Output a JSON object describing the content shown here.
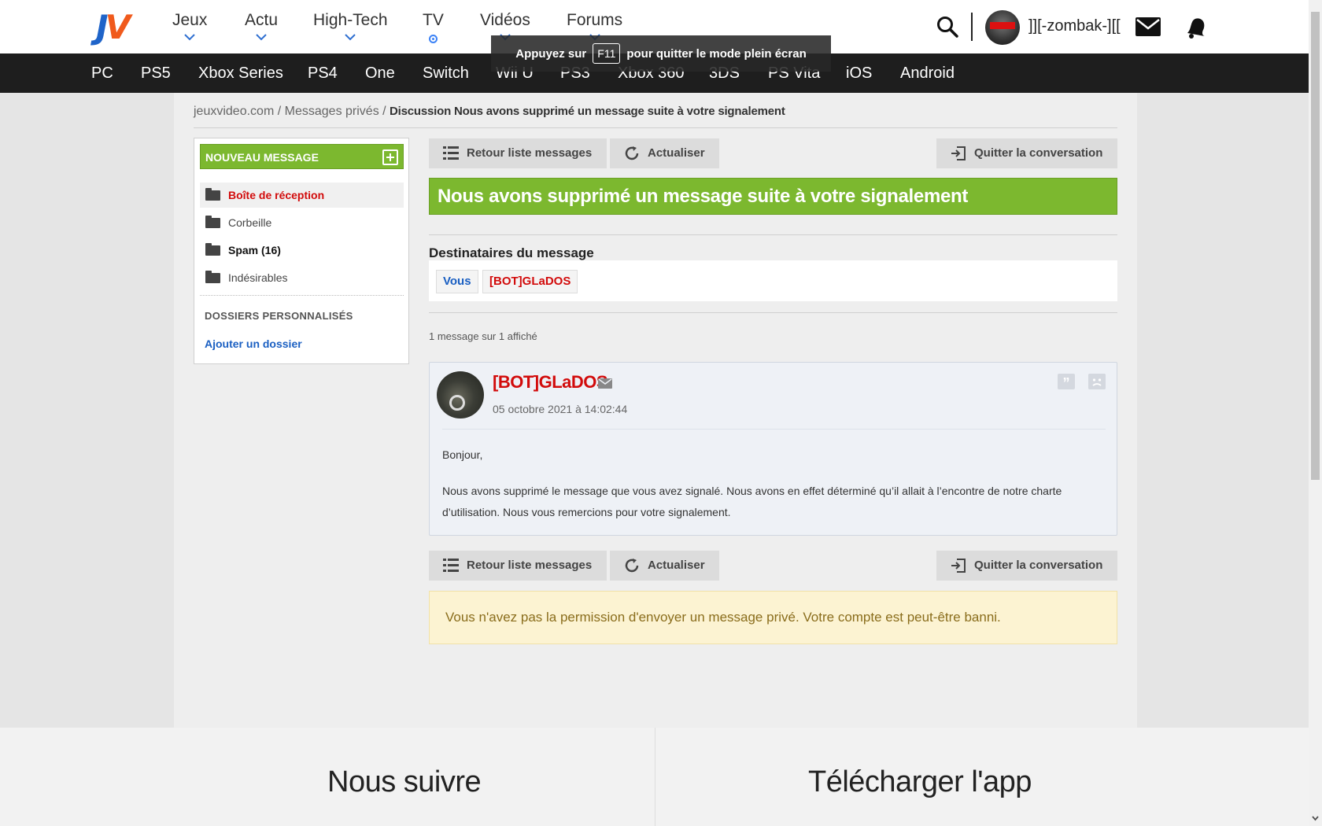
{
  "header": {
    "logo": {
      "j": "J",
      "v": "V"
    },
    "nav": [
      {
        "label": "Jeux",
        "marker": "chevron"
      },
      {
        "label": "Actu",
        "marker": "chevron"
      },
      {
        "label": "High-Tech",
        "marker": "chevron"
      },
      {
        "label": "TV",
        "marker": "live-dot"
      },
      {
        "label": "Vidéos",
        "marker": "chevron"
      },
      {
        "label": "Forums",
        "marker": "chevron"
      }
    ],
    "username": "]][-zombak-][[",
    "icons": [
      "search-icon",
      "mail-icon",
      "bell-icon"
    ]
  },
  "fullscreen_notice": {
    "before": "Appuyez sur",
    "key": "F11",
    "after": "pour quitter le mode plein écran"
  },
  "platforms": [
    "PC",
    "PS5",
    "Xbox Series",
    "PS4",
    "One",
    "Switch",
    "Wii U",
    "PS3",
    "Xbox 360",
    "3DS",
    "PS Vita",
    "iOS",
    "Android"
  ],
  "breadcrumb": {
    "home": "jeuxvideo.com",
    "sep": "/",
    "section": "Messages privés",
    "current": "Discussion Nous avons supprimé un message suite à votre signalement"
  },
  "sidebar": {
    "new_message": "NOUVEAU MESSAGE",
    "folders": [
      {
        "label": "Boîte de réception",
        "state": "active"
      },
      {
        "label": "Corbeille",
        "state": "normal"
      },
      {
        "label": "Spam (16)",
        "state": "bold"
      },
      {
        "label": "Indésirables",
        "state": "normal"
      }
    ],
    "custom_title": "DOSSIERS PERSONNALISÉS",
    "add_folder": "Ajouter un dossier"
  },
  "toolbar": {
    "back": "Retour liste messages",
    "refresh": "Actualiser",
    "leave": "Quitter la conversation"
  },
  "conversation": {
    "title": "Nous avons supprimé un message suite à votre signalement",
    "recipients_title": "Destinataires du message",
    "recipients": [
      {
        "name": "Vous",
        "color": "#1a5fc2"
      },
      {
        "name": "[BOT]GLaDOS",
        "color": "#d20b0b"
      }
    ],
    "count_text": "1 message sur 1 affiché"
  },
  "message": {
    "author": "[BOT]GLaDOS",
    "date": "05 octobre 2021 à 14:02:44",
    "greeting": "Bonjour,",
    "body": "Nous avons supprimé le message que vous avez signalé. Nous avons en effet déterminé qu’il allait à l’encontre de notre charte d’utilisation. Nous vous remercions pour votre signalement."
  },
  "warning": "Vous n'avez pas la permission d'envoyer un message privé. Votre compte est peut-être banni.",
  "footer": {
    "follow": "Nous suivre",
    "app": "Télécharger l'app"
  },
  "colors": {
    "brand_green": "#7cb82f",
    "author_red": "#d20b0b",
    "link_blue": "#1a5fc2",
    "platform_bar": "#1e1e1e"
  }
}
